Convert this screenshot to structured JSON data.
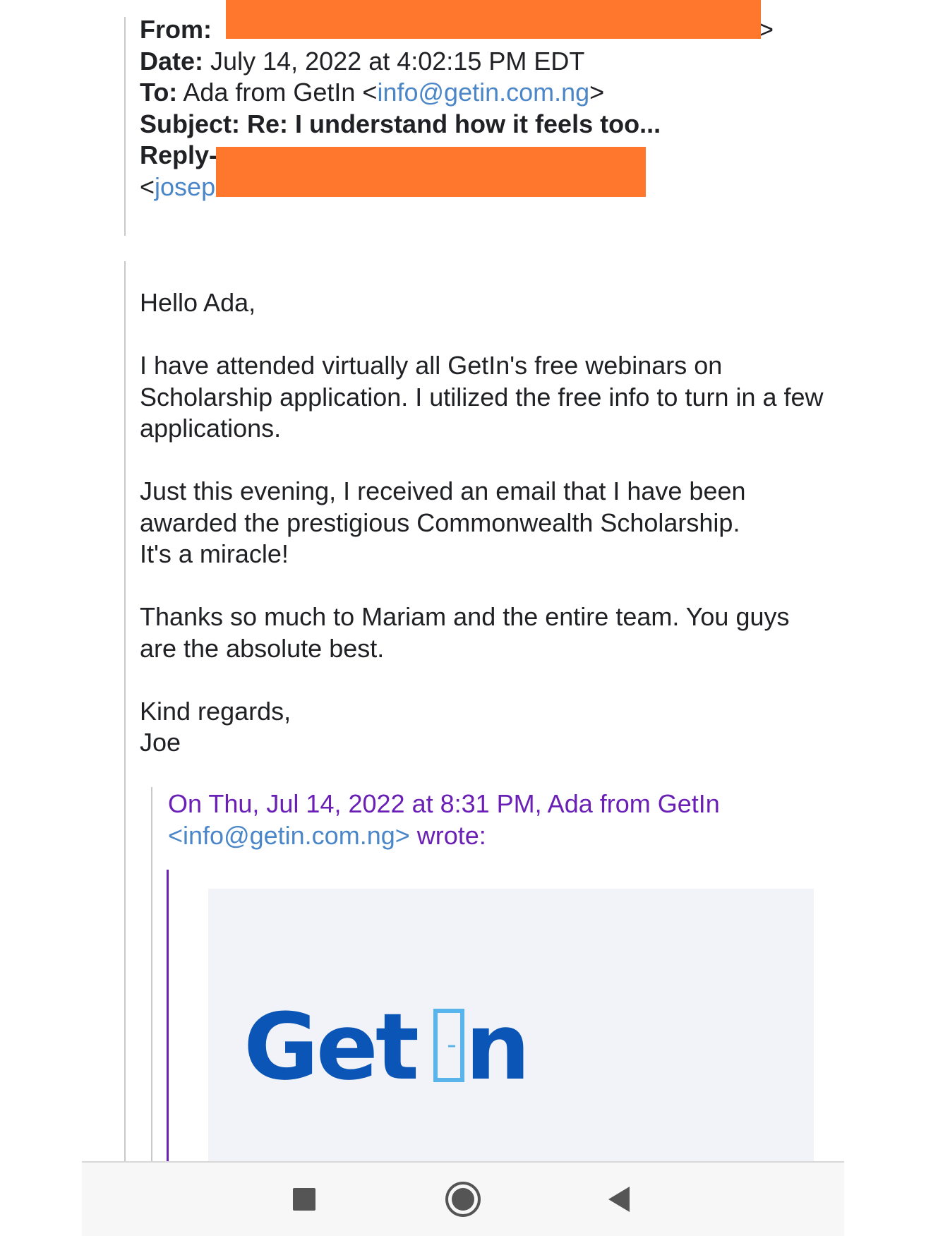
{
  "header": {
    "from_label": "From:",
    "from_tail": ">",
    "date_label": "Date:",
    "date_value": "July 14, 2022 at 4:02:15 PM EDT",
    "to_label": "To:",
    "to_name": "Ada from GetIn <",
    "to_email": "info@getin.com.ng",
    "to_close": ">",
    "subject_label": "Subject:",
    "subject_value": "Re: I understand how it feels too...",
    "replyto_label": "Reply-",
    "replyto_open": "<",
    "replyto_email_partial": "josep"
  },
  "message": {
    "greeting": "Hello Ada,",
    "para1": "I have attended virtually all GetIn's free webinars on Scholarship application. I utilized the free info to turn in a few applications.",
    "para2_line1": "Just this evening, I received an email that I have been awarded the prestigious Commonwealth Scholarship.",
    "para2_line2": "It's a miracle!",
    "para3": "Thanks so much to Mariam and the entire team. You guys are the absolute best.",
    "signoff": "Kind regards,",
    "signature": "Joe"
  },
  "quote": {
    "attribution": "On Thu, Jul 14, 2022 at 8:31 PM, Ada from GetIn",
    "email": "<info@getin.com.ng>",
    "wrote": " wrote:"
  },
  "logo": {
    "part1": "Get",
    "part2": "n"
  },
  "colors": {
    "redaction": "#ff772d",
    "link": "#4a86c8",
    "quote": "#6a1fb5",
    "logo_blue": "#0a55b5",
    "logo_door": "#5ab4ec",
    "logo_bg": "#f1f3f8"
  },
  "navbar": {
    "icons": [
      "recent-apps-icon",
      "home-icon",
      "back-icon"
    ]
  }
}
